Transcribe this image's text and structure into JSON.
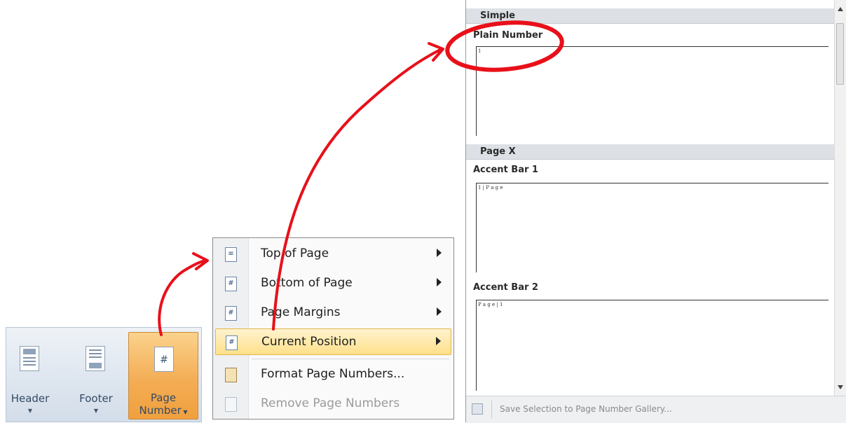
{
  "ribbon": {
    "header_label": "Header",
    "footer_label": "Footer",
    "page_number_label_line1": "Page",
    "page_number_label_line2": "Number",
    "page_number_icon_glyph": "#"
  },
  "menu": {
    "items": [
      {
        "label": "Top of Page",
        "icon": "page-top-icon",
        "glyph": "≡"
      },
      {
        "label": "Bottom of Page",
        "icon": "page-bottom-icon",
        "glyph": "#"
      },
      {
        "label": "Page Margins",
        "icon": "page-margins-icon",
        "glyph": "#"
      },
      {
        "label": "Current Position",
        "icon": "page-current-icon",
        "glyph": "#"
      },
      {
        "label": "Format Page Numbers...",
        "icon": "format-icon"
      },
      {
        "label": "Remove Page Numbers",
        "icon": "remove-icon"
      }
    ]
  },
  "gallery": {
    "section1_header": "Simple",
    "item1_title": "Plain Number",
    "item1_preview": "1",
    "section2_header": "Page X",
    "item2_title": "Accent Bar 1",
    "item2_preview": "1 | P a g e",
    "item3_title": "Accent Bar 2",
    "item3_preview": "P a g e | 1",
    "footer_label": "Save Selection to Page Number Gallery..."
  },
  "colors": {
    "annotation": "#e8101a",
    "highlight": "#ffe08a",
    "ribbon_active": "#f4ad55"
  }
}
